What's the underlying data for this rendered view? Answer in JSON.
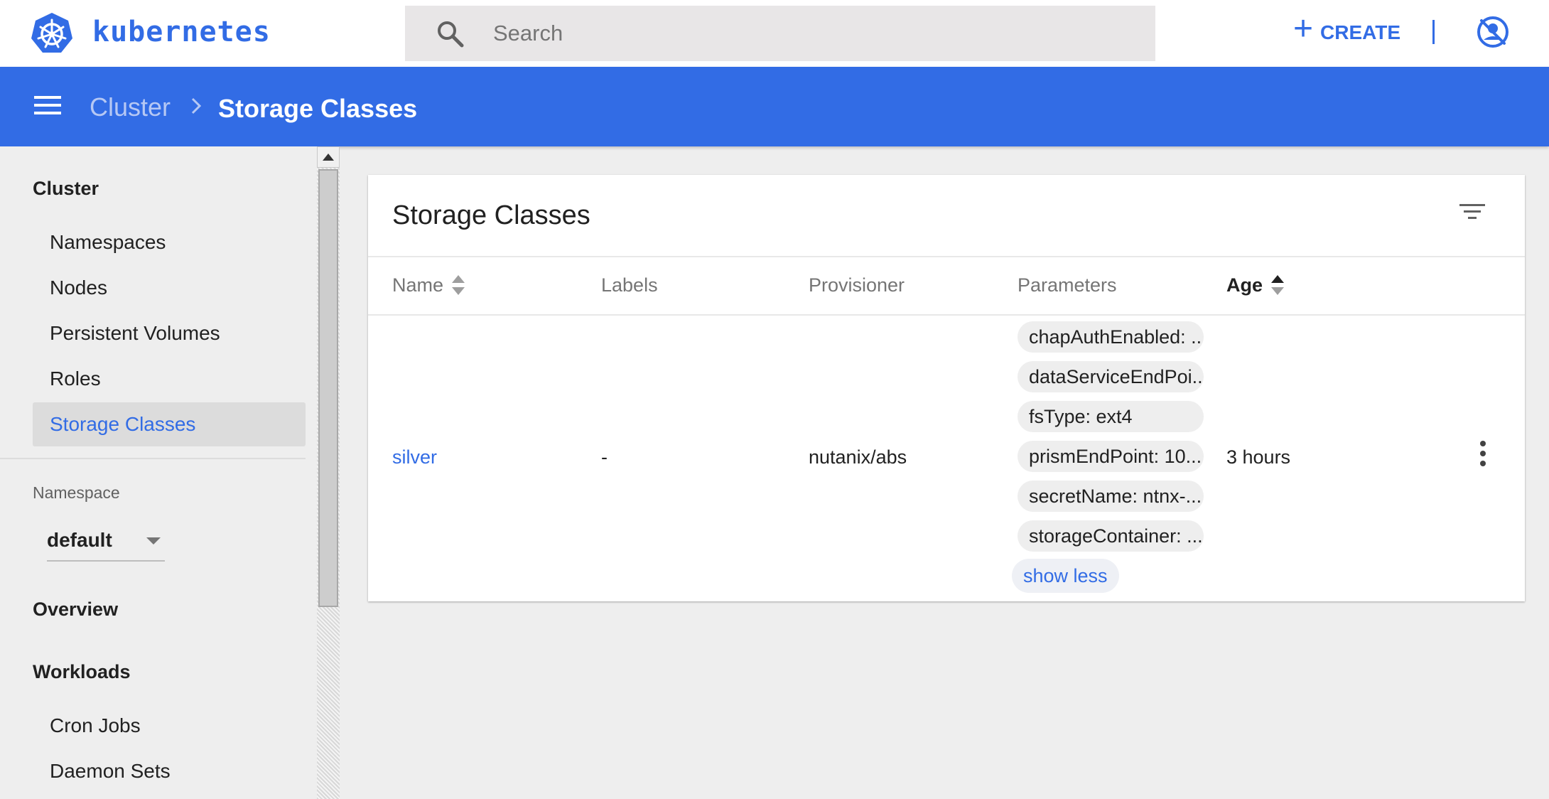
{
  "app": {
    "brand": "kubernetes",
    "search_placeholder": "Search",
    "create_label": "CREATE"
  },
  "breadcrumb": {
    "root": "Cluster",
    "current": "Storage Classes"
  },
  "sidebar": {
    "cluster_title": "Cluster",
    "cluster_items": [
      {
        "label": "Namespaces"
      },
      {
        "label": "Nodes"
      },
      {
        "label": "Persistent Volumes"
      },
      {
        "label": "Roles"
      },
      {
        "label": "Storage Classes",
        "active": true
      }
    ],
    "namespace_label": "Namespace",
    "namespace_value": "default",
    "overview_title": "Overview",
    "workloads_title": "Workloads",
    "workload_items": [
      {
        "label": "Cron Jobs"
      },
      {
        "label": "Daemon Sets"
      }
    ]
  },
  "card": {
    "title": "Storage Classes",
    "columns": {
      "name": "Name",
      "labels": "Labels",
      "provisioner": "Provisioner",
      "parameters": "Parameters",
      "age": "Age"
    },
    "rows": [
      {
        "name": "silver",
        "labels": "-",
        "provisioner": "nutanix/abs",
        "parameters": [
          "chapAuthEnabled: ...",
          "dataServiceEndPoi...",
          "fsType: ext4",
          "prismEndPoint: 10...",
          "secretName: ntnx-...",
          "storageContainer: ..."
        ],
        "show_less": "show less",
        "age": "3 hours"
      }
    ]
  },
  "colors": {
    "primary": "#326ce5",
    "background": "#eeeeee",
    "chip": "#eeeeee"
  },
  "icons": {
    "logo": "kubernetes-wheel-icon",
    "search": "search-icon",
    "create": "plus-icon",
    "account": "account-off-icon",
    "menu": "hamburger-menu-icon",
    "breadcrumb_separator": "chevron-right-icon",
    "filter": "filter-list-icon",
    "row_actions": "more-vert-icon"
  }
}
